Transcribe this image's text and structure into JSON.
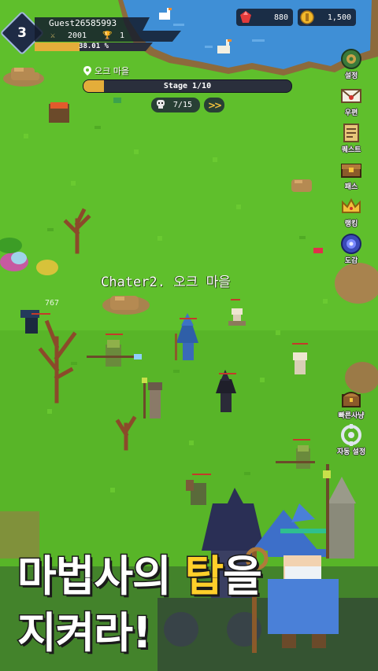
{
  "player": {
    "level": "3",
    "name": "Guest26585993",
    "attack": "2001",
    "trophy": "1",
    "exp_text": "38.01 %",
    "exp_fraction": 0.3801
  },
  "currency": {
    "gems": "880",
    "gold": "1,500"
  },
  "stage": {
    "location": "오크 마을",
    "label": "Stage 1/10",
    "progress_fraction": 0.1,
    "wave": "7/15"
  },
  "side_menu_top": [
    {
      "label": "설정",
      "icon": "settings-icon"
    },
    {
      "label": "우편",
      "icon": "mail-icon"
    },
    {
      "label": "퀘스트",
      "icon": "quest-icon"
    },
    {
      "label": "패스",
      "icon": "pass-icon"
    },
    {
      "label": "랭킹",
      "icon": "ranking-icon"
    },
    {
      "label": "도감",
      "icon": "codex-icon"
    }
  ],
  "side_menu_bottom": [
    {
      "label": "빠른사냥",
      "icon": "quick-hunt-icon"
    },
    {
      "label": "자동 설정",
      "icon": "auto-setting-icon"
    }
  ],
  "field": {
    "chapter_title": "Chater2. 오크 마을",
    "damage_number": "767"
  },
  "banner": {
    "line1_a": "마법사의 ",
    "line1_b": "탑",
    "line1_c": "을",
    "line2": "지켜라!"
  },
  "colors": {
    "grass": "#5fbf2c",
    "water": "#3f8fd6",
    "gold_accent": "#e4ad3a",
    "hud_dark": "#1e2b45",
    "banner_yellow": "#ffcf2a"
  }
}
